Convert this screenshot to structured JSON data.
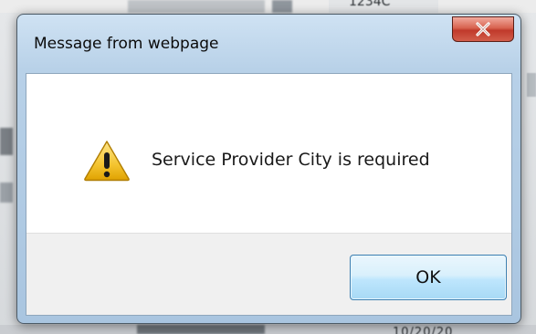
{
  "background": {
    "top_partial_text": "1234C",
    "bottom_partial_text": "10/20/20"
  },
  "dialog": {
    "title": "Message from webpage",
    "close_icon": "close-icon",
    "warning_icon": "warning-icon",
    "message": "Service Provider City is required",
    "ok_label": "OK",
    "colors": {
      "title_bar": "#b8d1e8",
      "close_button": "#c0392b",
      "ok_button": "#bee6fd",
      "footer": "#f0f0f0",
      "warning": "#f4c430"
    }
  }
}
